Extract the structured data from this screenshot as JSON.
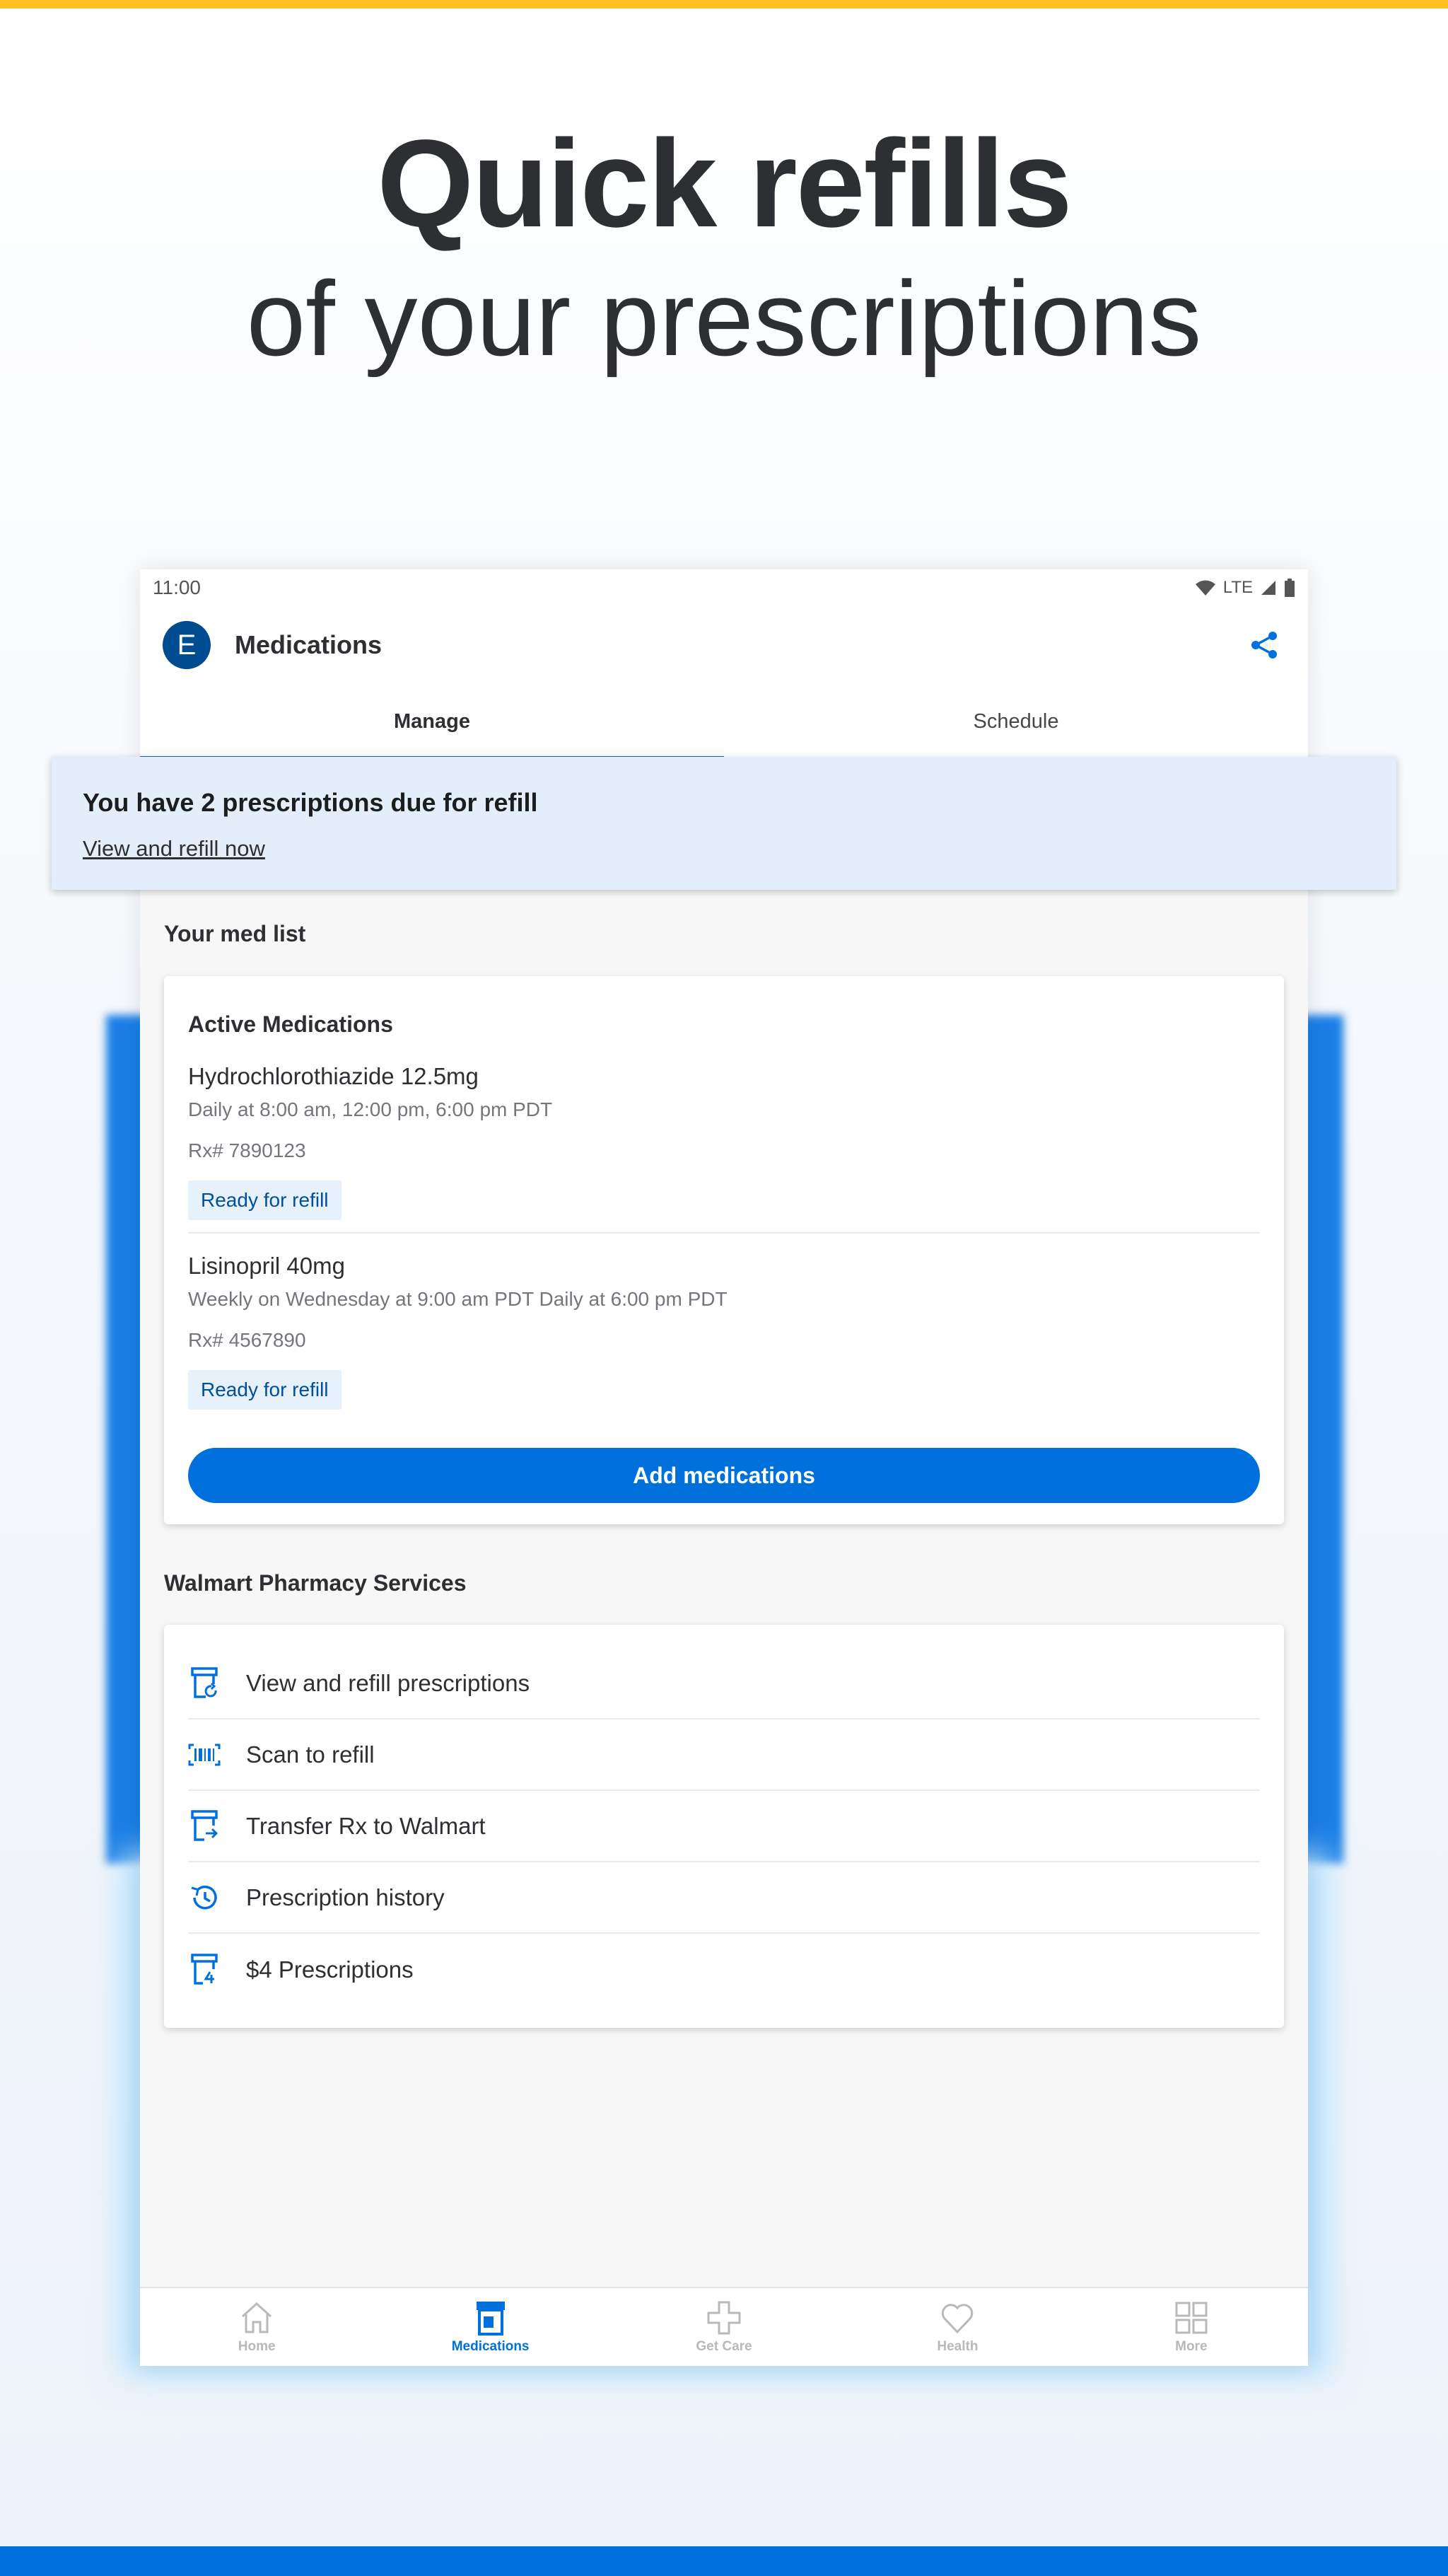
{
  "hero": {
    "title": "Quick refills",
    "subtitle": "of your prescriptions"
  },
  "colors": {
    "accent": "#0071dc",
    "brand_yellow": "#ffc220",
    "avatar_blue": "#004c91",
    "badge_bg": "#e6f1fc",
    "banner_bg": "#e4eefa"
  },
  "status_bar": {
    "time": "11:00",
    "network": "LTE",
    "icons": [
      "wifi-icon",
      "signal-icon",
      "battery-icon"
    ]
  },
  "app_bar": {
    "avatar_initial": "E",
    "title": "Medications",
    "action_icon": "share-icon"
  },
  "tabs": [
    {
      "label": "Manage",
      "active": true
    },
    {
      "label": "Schedule",
      "active": false
    }
  ],
  "refill_banner": {
    "title": "You have 2 prescriptions due for refill",
    "link": "View and refill now"
  },
  "med_list": {
    "section_title": "Your med list",
    "card_title": "Active Medications",
    "items": [
      {
        "name": "Hydrochlorothiazide 12.5mg",
        "schedule": "Daily at 8:00 am, 12:00 pm, 6:00 pm PDT",
        "rx": "Rx# 7890123",
        "status": "Ready for refill"
      },
      {
        "name": "Lisinopril 40mg",
        "schedule": "Weekly on Wednesday at 9:00 am PDT Daily at 6:00 pm PDT",
        "rx": "Rx# 4567890",
        "status": "Ready for refill"
      }
    ],
    "add_button": "Add medications"
  },
  "services": {
    "section_title": "Walmart Pharmacy Services",
    "items": [
      {
        "label": "View and refill prescriptions",
        "icon": "refill-bottle-icon"
      },
      {
        "label": "Scan to refill",
        "icon": "barcode-icon"
      },
      {
        "label": "Transfer Rx to Walmart",
        "icon": "transfer-bottle-icon"
      },
      {
        "label": "Prescription history",
        "icon": "history-icon"
      },
      {
        "label": "$4 Prescriptions",
        "icon": "four-dollar-bottle-icon"
      }
    ]
  },
  "bottom_nav": [
    {
      "label": "Home",
      "icon": "home-icon",
      "active": false
    },
    {
      "label": "Medications",
      "icon": "medications-icon",
      "active": true
    },
    {
      "label": "Get Care",
      "icon": "plus-cross-icon",
      "active": false
    },
    {
      "label": "Health",
      "icon": "heart-icon",
      "active": false
    },
    {
      "label": "More",
      "icon": "grid-icon",
      "active": false
    }
  ]
}
